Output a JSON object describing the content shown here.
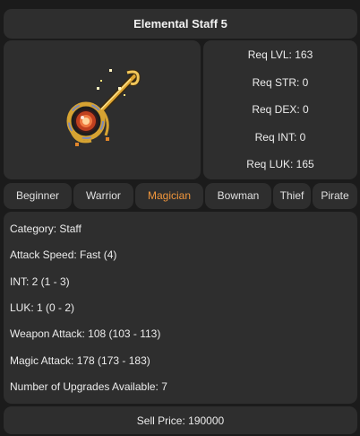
{
  "item": {
    "title": "Elemental Staff 5",
    "icon": "elemental-staff-icon"
  },
  "requirements": [
    "Req LVL: 163",
    "Req STR: 0",
    "Req DEX: 0",
    "Req INT: 0",
    "Req LUK: 165"
  ],
  "job_tabs": [
    {
      "label": "Beginner",
      "active": false
    },
    {
      "label": "Warrior",
      "active": false
    },
    {
      "label": "Magician",
      "active": true
    },
    {
      "label": "Bowman",
      "active": false
    },
    {
      "label": "Thief",
      "active": false
    },
    {
      "label": "Pirate",
      "active": false
    }
  ],
  "stats": [
    "Category: Staff",
    "Attack Speed: Fast (4)",
    "INT: 2 (1 - 3)",
    "LUK: 1 (0 - 2)",
    "Weapon Attack: 108 (103 - 113)",
    "Magic Attack: 178 (173 - 183)",
    "Number of Upgrades Available: 7"
  ],
  "sell_price": "Sell Price: 190000",
  "colors": {
    "active_tab": "#f0963c",
    "panel_bg": "#2e2e2e",
    "page_bg": "#1b1b1b"
  }
}
